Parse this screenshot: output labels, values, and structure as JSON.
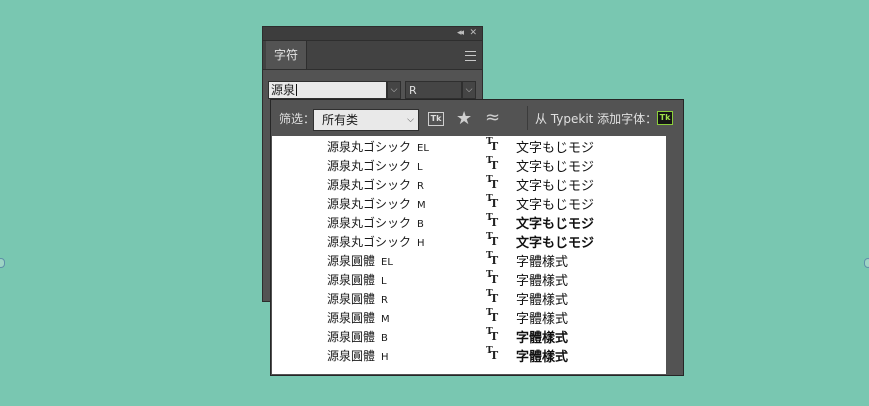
{
  "colors": {
    "background": "#79c7b1",
    "panel": "#535353",
    "typekit_green": "#9fe04a"
  },
  "character_panel": {
    "tab_label": "字符",
    "font_family_value": "源泉",
    "font_style_value": "R",
    "icons": [
      "collapse-icon",
      "close-icon",
      "panel-menu-icon"
    ]
  },
  "font_picker": {
    "filter_label": "筛选：",
    "category_value": "所有类",
    "typekit_add_label": "从 Typekit 添加字体：",
    "typekit_icon_text": "Tk",
    "fonts": [
      {
        "family": "源泉丸ゴシック",
        "style": "EL",
        "sample": "文字もじモジ",
        "weight": 200
      },
      {
        "family": "源泉丸ゴシック",
        "style": "L",
        "sample": "文字もじモジ",
        "weight": 300
      },
      {
        "family": "源泉丸ゴシック",
        "style": "R",
        "sample": "文字もじモジ",
        "weight": 400
      },
      {
        "family": "源泉丸ゴシック",
        "style": "M",
        "sample": "文字もじモジ",
        "weight": 500
      },
      {
        "family": "源泉丸ゴシック",
        "style": "B",
        "sample": "文字もじモジ",
        "weight": 700
      },
      {
        "family": "源泉丸ゴシック",
        "style": "H",
        "sample": "文字もじモジ",
        "weight": 900
      },
      {
        "family": "源泉圓體",
        "style": "EL",
        "sample": "字體樣式",
        "weight": 200
      },
      {
        "family": "源泉圓體",
        "style": "L",
        "sample": "字體樣式",
        "weight": 300
      },
      {
        "family": "源泉圓體",
        "style": "R",
        "sample": "字體樣式",
        "weight": 400
      },
      {
        "family": "源泉圓體",
        "style": "M",
        "sample": "字體樣式",
        "weight": 500
      },
      {
        "family": "源泉圓體",
        "style": "B",
        "sample": "字體樣式",
        "weight": 700
      },
      {
        "family": "源泉圓體",
        "style": "H",
        "sample": "字體樣式",
        "weight": 900
      }
    ]
  }
}
